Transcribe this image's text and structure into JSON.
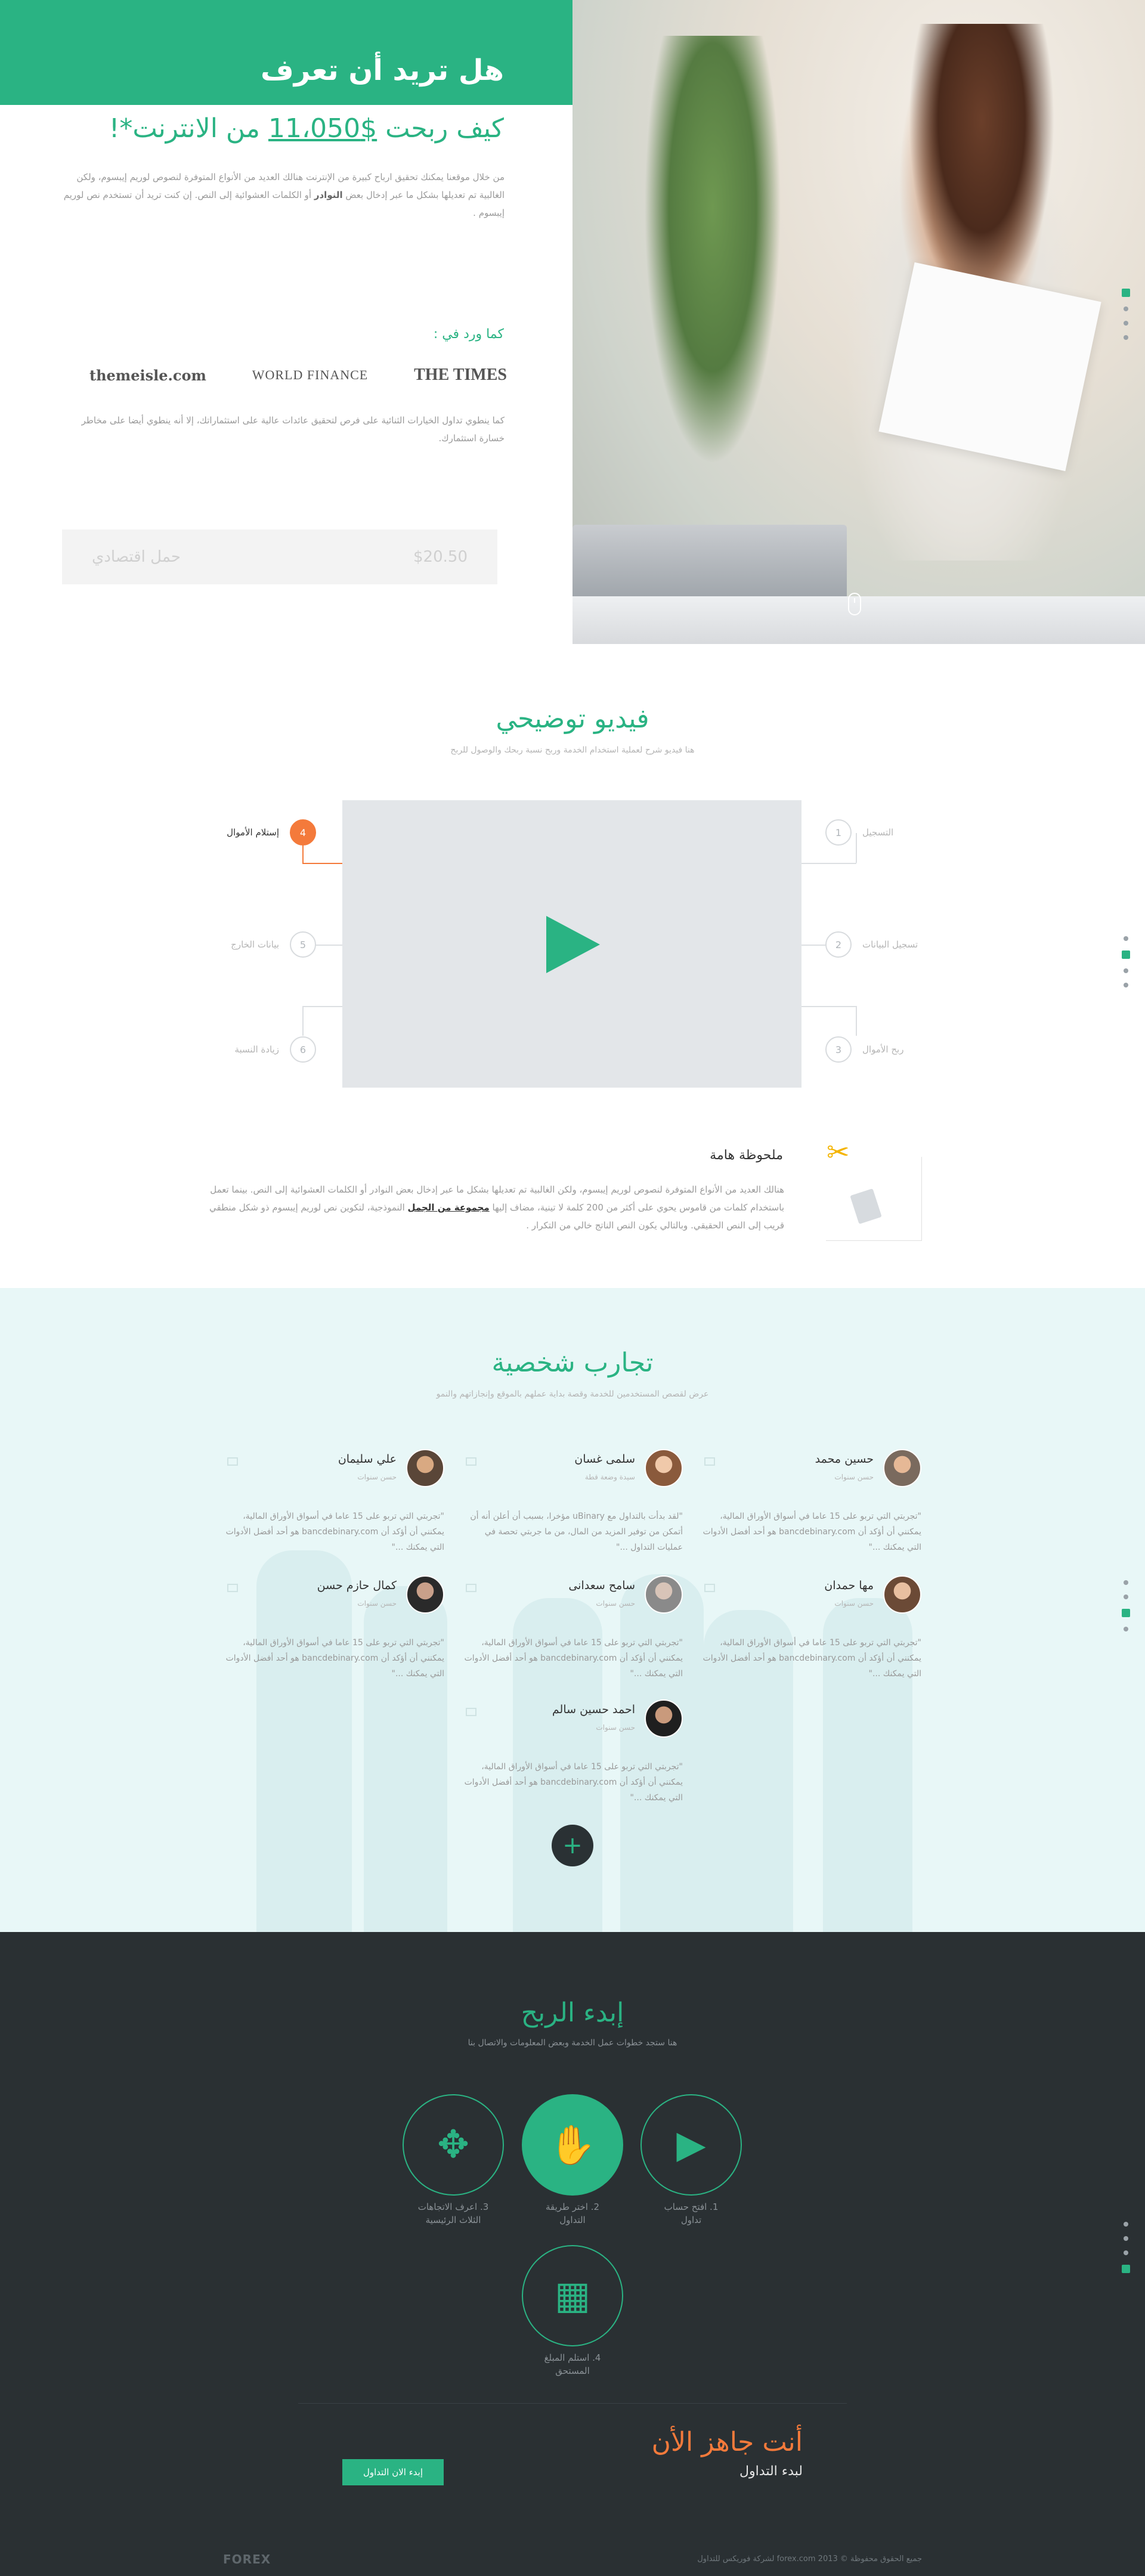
{
  "hero": {
    "title": "هل تريد أن تعرف",
    "subtitle_pre": "كيف ربحت ",
    "subtitle_amount": "$11،050",
    "subtitle_post": " من الانترنت*!",
    "paragraph_1": "من خلال موقعنا يمكنك تحقيق ارباح كبيرة من الإنترنت هنالك العديد من الأنواع المتوفرة لنصوص لوريم إيبسوم، ولكن الغالبية تم تعديلها بشكل ما عبر إدخال بعض",
    "paragraph_1_bold": "النوادر",
    "paragraph_1_tail": "أو الكلمات العشوائية إلى النص. إن كنت تريد أن تستخدم نص لوريم إيبسوم .",
    "as_seen": "كما ورد في :",
    "logos": [
      "themeisle.com",
      "WORLD FINANCE",
      "THE TIMES"
    ],
    "paragraph_2": "كما ينطوي تداول الخيارات الثنائية على فرص لتحقيق عائدات عالية على استثماراتك، إلا أنه ينطوي أيضا على مخاطر خسارة استثمارك.",
    "form_placeholder_1": "حمل اقتصادي",
    "form_placeholder_2": "$20.50"
  },
  "video": {
    "title": "فيديو توضيحي",
    "subtitle": "هنا فيديو شرح لعملية استخدام الخدمة وربح نسبة ربحك والوصول للربح",
    "steps": [
      {
        "n": "1",
        "label": "التسجيل"
      },
      {
        "n": "2",
        "label": "تسجيل البيانات"
      },
      {
        "n": "3",
        "label": "ربح الأموال"
      },
      {
        "n": "4",
        "label": "إستلام الأموال"
      },
      {
        "n": "5",
        "label": "بيانات الخارج"
      },
      {
        "n": "6",
        "label": "زيادة النسبة"
      }
    ],
    "note_title": "ملحوظة هامة",
    "note_text_1": "هنالك العديد من الأنواع المتوفرة لنصوص لوريم إيبسوم، ولكن الغالبية تم تعديلها بشكل ما عبر إدخال بعض النوادر أو الكلمات العشوائية إلى النص. بينما تعمل باستخدام كلمات من قاموس يحوي على أكثر من 200 كلمة لا تينية، مضاف إليها",
    "note_link": "مجموعة من الجمل",
    "note_text_2": "النموذجية، لتكوين نص لوريم إيبسوم ذو شكل منطقي قريب إلى النص الحقيقي. وبالتالي يكون النص الناتج خالي من التكرار ."
  },
  "testimonials": {
    "title": "تجارب شخصية",
    "subtitle": "عرض لقصص المستخدمين للخدمة وقصة بداية عملهم بالموقع وإنجازاتهم والنمو",
    "items": [
      {
        "name": "حسين محمد",
        "role": "حسن سنوات",
        "quote": "\"تجربتي التي تربو على 15 عاما في أسواق الأوراق المالية، يمكنني أن أؤكد أن bancdebinary.com هو أحد أفضل الأدوات التي يمكنك ...\""
      },
      {
        "name": "سلمى غسان",
        "role": "سيدة وضعة قطة",
        "quote": "\"لقد بدأت بالتداول مع uBinary مؤخرا، بسبب أن أعلن أنه أن أتمكن من توفير المزيد من المال، من ما جربتي تحصة في عمليات التداول ...\""
      },
      {
        "name": "علي سليمان",
        "role": "حسن سنوات",
        "quote": "\"تجربتي التي تربو على 15 عاما في أسواق الأوراق المالية، يمكنني أن أؤكد أن bancdebinary.com هو أحد أفضل الأدوات التي يمكنك ...\""
      },
      {
        "name": "مها حمدان",
        "role": "حسن سنوات",
        "quote": "\"تجربتي التي تربو على 15 عاما في أسواق الأوراق المالية، يمكنني أن أؤكد أن bancdebinary.com هو أحد أفضل الأدوات التي يمكنك ...\""
      },
      {
        "name": "سامح سعدانى",
        "role": "حسن سنوات",
        "quote": "\"تجربتي التي تربو على 15 عاما في أسواق الأوراق المالية، يمكنني أن أؤكد أن bancdebinary.com هو أحد أفضل الأدوات التي يمكنك ...\""
      },
      {
        "name": "كمال حازم حسن",
        "role": "حسن سنوات",
        "quote": "\"تجربتي التي تربو على 15 عاما في أسواق الأوراق المالية، يمكنني أن أؤكد أن bancdebinary.com هو أحد أفضل الأدوات التي يمكنك ...\""
      },
      {
        "name": "احمد حسين سالم",
        "role": "حسن سنوات",
        "quote": "\"تجربتي التي تربو على 15 عاما في أسواق الأوراق المالية، يمكنني أن أؤكد أن bancdebinary.com هو أحد أفضل الأدوات التي يمكنك ...\""
      }
    ],
    "more_label": "+"
  },
  "start": {
    "title": "إبدء الربح",
    "subtitle": "هنا ستجد خطوات عمل الخدمة وبعض المعلومات والاتصال بنا",
    "steps": [
      {
        "label_1": "1. افتح حساب",
        "label_2": "تداول",
        "icon": "play-flag-icon"
      },
      {
        "label_1": "2. اختر طريقة",
        "label_2": "التداول",
        "icon": "hand-box-icon"
      },
      {
        "label_1": "3. اعرف الاتجاهات",
        "label_2": "الثلاث الرئيسية",
        "icon": "arrows-icon"
      },
      {
        "label_1": "4. استلم المبلغ",
        "label_2": "المستحق",
        "icon": "calculator-icon"
      }
    ],
    "ready_title": "أنت جاهز الأن",
    "ready_sub": "لبدء التداول",
    "ready_button": "إبدء الان التداول",
    "footer_logo": "FOREX",
    "footer_copy": "جميع الحقوق محفوظة © 2013 forex.com لشركة فوريكس للتداول"
  },
  "colors": {
    "accent": "#2ab383",
    "orange": "#f47a3b",
    "dark": "#2a3033"
  }
}
